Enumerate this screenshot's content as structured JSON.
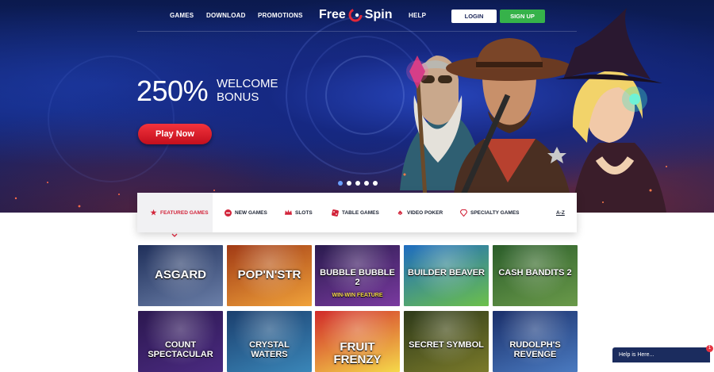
{
  "nav": {
    "games": "GAMES",
    "download": "DOWNLOAD",
    "promotions": "PROMOTIONS",
    "help": "HELP",
    "login": "LOGIN",
    "signup": "SIGN UP"
  },
  "logo": {
    "left": "Free",
    "right": "Spin"
  },
  "hero": {
    "percent": "250%",
    "line1": "WELCOME",
    "line2": "BONUS",
    "cta": "Play Now",
    "slides": 5,
    "active_slide": 1
  },
  "categories": [
    {
      "label": "FEATURED GAMES",
      "icon": "star-icon",
      "active": true
    },
    {
      "label": "NEW GAMES",
      "icon": "new-badge-icon",
      "active": false
    },
    {
      "label": "SLOTS",
      "icon": "crown-icon",
      "active": false
    },
    {
      "label": "TABLE GAMES",
      "icon": "dice-icon",
      "active": false
    },
    {
      "label": "VIDEO POKER",
      "icon": "club-icon",
      "active": false
    },
    {
      "label": "SPECIALTY GAMES",
      "icon": "diamond-icon",
      "active": false
    },
    {
      "label": "A-Z",
      "icon": "",
      "active": false
    }
  ],
  "games": [
    {
      "title": "ASGARD",
      "colors": [
        "#1f2f5a",
        "#6b7fa8"
      ]
    },
    {
      "title": "POP'N'STR",
      "colors": [
        "#a13a15",
        "#f0a23a"
      ]
    },
    {
      "title": "BUBBLE BUBBLE 2",
      "sub": "WIN-WIN FEATURE",
      "colors": [
        "#2a1b4e",
        "#7a3aa0"
      ]
    },
    {
      "title": "BUILDER BEAVER",
      "colors": [
        "#1e6cc0",
        "#6cc04a"
      ]
    },
    {
      "title": "CASH BANDITS 2",
      "colors": [
        "#2b5d2a",
        "#6a9a4a"
      ]
    },
    {
      "title": "COUNT SPECTACULAR",
      "colors": [
        "#2c1850",
        "#4a2a80"
      ]
    },
    {
      "title": "CRYSTAL WATERS",
      "colors": [
        "#1b3f6e",
        "#3a86b8"
      ]
    },
    {
      "title": "FRUIT FRENZY",
      "colors": [
        "#d12a2a",
        "#f5d94a"
      ]
    },
    {
      "title": "SECRET SYMBOL",
      "colors": [
        "#2e3a1a",
        "#7a7a2a"
      ]
    },
    {
      "title": "RUDOLPH'S REVENGE",
      "colors": [
        "#1a2f6a",
        "#4a7ac0"
      ]
    }
  ],
  "help": {
    "label": "Help is Here...",
    "badge": "1"
  },
  "colors": {
    "accent": "#d2243a",
    "signup": "#36b24a",
    "navy": "#1b2c5e"
  }
}
